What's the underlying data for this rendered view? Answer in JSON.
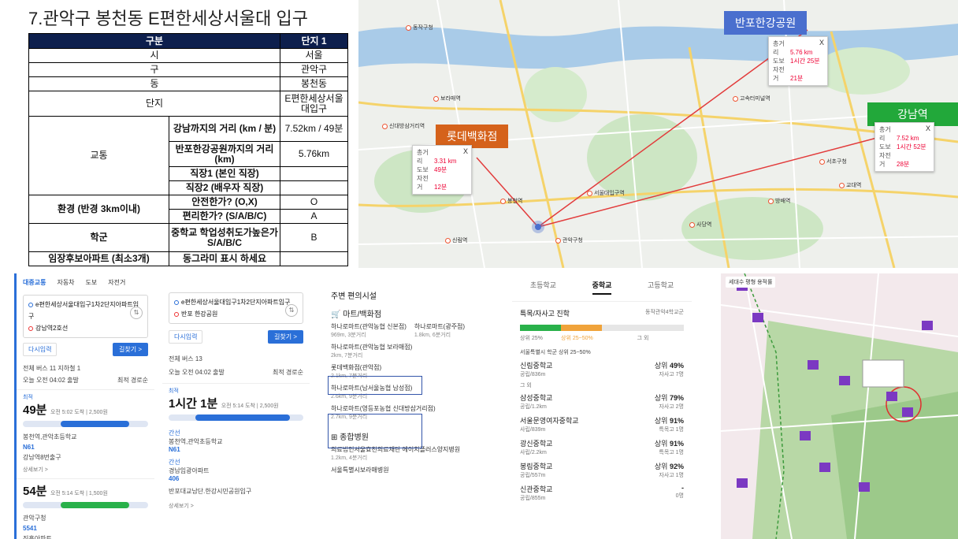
{
  "title": "7.관악구 봉천동 E편한세상서울대 입구",
  "table": {
    "header_left": "구분",
    "header_right": "단지 1",
    "rows": {
      "si_label": "시",
      "si_value": "서울",
      "gu_label": "구",
      "gu_value": "관악구",
      "dong_label": "동",
      "dong_value": "봉천동",
      "danji_label": "단지",
      "danji_value": "E편한세상서울대입구",
      "transport_label": "교통",
      "gangnam_label": "강남까지의 거리 (km / 분)",
      "gangnam_value": "7.52km / 49분",
      "banpo_label": "반포한강공원까지의 거리 (km)",
      "banpo_value": "5.76km",
      "job1_label": "직장1 (본인 직장)",
      "job2_label": "직장2 (배우자 직장)",
      "env_label": "환경 (반경 3km이내)",
      "safe_label": "안전한가? (O,X)",
      "safe_value": "O",
      "convenient_label": "편리한가? (S/A/B/C)",
      "convenient_value": "A",
      "school_label": "학군",
      "school_q_label": "중학교 학업성취도가높은가 S/A/B/C",
      "school_q_value": "B",
      "near_label": "임장후보아파트 (최소3개)",
      "near_value": "동그라미 표시 하세요"
    }
  },
  "map": {
    "banpo_label": "반포한강공원",
    "gangnam_label": "강남역",
    "lotte_label": "롯데백화점",
    "colors": {
      "blue_label": "#4a6fce",
      "green_label": "#22a83a",
      "orange_label": "#d5621b",
      "route": "#e23b3b"
    },
    "infobox_banpo": {
      "k1": "총거리",
      "v1": "5.76 km",
      "k2": "도보",
      "v2": "1시간 25분",
      "k3": "자전거",
      "v3": "21분"
    },
    "infobox_gangnam": {
      "k1": "총거리",
      "v1": "7.52 km",
      "k2": "도보",
      "v2": "1시간 52분",
      "k3": "자전거",
      "v3": "28분"
    },
    "infobox_lotte": {
      "k1": "총거리",
      "v1": "3.31 km",
      "k2": "도보",
      "v2": "49분",
      "k3": "자전거",
      "v3": "12분"
    },
    "close": "X",
    "pois": [
      "동작구청",
      "신대방삼거리역",
      "보라매역",
      "관악구청",
      "서울대입구역",
      "봉천역",
      "서초구청",
      "교대역",
      "방배역",
      "사당역",
      "고속터미널역",
      "신림역"
    ]
  },
  "panel1": {
    "tabs": [
      "대중교통",
      "자동차",
      "도보",
      "자전거"
    ],
    "from": "e편한세상서울대입구1차2단지아파트입구",
    "to": "강남역2호선",
    "reset": "다시입력",
    "search": "길찾기 >",
    "filters": "전체  버스 11  지하철 1",
    "today": "오늘 오전 04:02 출발",
    "sort": "최적 경로순",
    "best": "최적",
    "time1": "49분",
    "time1_detail": "오전 5:02 도착 | 2,500원",
    "bus1": "N61",
    "bus1_stop": "봉천역,관악초등학교",
    "stop_dest": "강남역8번출구",
    "more": "상세보기 >",
    "time2": "54분",
    "time2_detail": "오전 5:14 도착 | 1,500원",
    "bus2": "5541",
    "bus2_stop": "관악구청",
    "stop_dest2": "진흥아파트"
  },
  "panel2": {
    "from": "e편한세상서울대입구1차2단지아파트입구",
    "to": "반포 한강공원",
    "reset": "다시입력",
    "search": "길찾기 >",
    "filters": "전체  버스 13",
    "today": "오늘 오전 04:02 출발",
    "sort": "최적 경로순",
    "best": "최적",
    "time": "1시간 1분",
    "time_detail": "오전 5:14 도착 | 2,500원",
    "line1": "간선",
    "stop1": "봉천역,관악초등학교",
    "bus1": "N61",
    "line2": "간선",
    "stop2": "경남임광아파트",
    "bus2": "406",
    "dest": "반포대교남단.한강시민공원입구",
    "more": "상세보기 >"
  },
  "panel3": {
    "heading": "주변 편의시설",
    "category1": "마트/백화점",
    "items": [
      {
        "name": "하나로마트(관악농협 신본점)",
        "dist": "969m, 3분거리"
      },
      {
        "name": "하나로마트(광주점)",
        "dist": "1.8km, 6분거리"
      },
      {
        "name": "하나로마트(관악농협 보라매점)",
        "dist": "2km, 7분거리"
      },
      {
        "name": "롯데백화점(관악점)",
        "dist": "2.1km, 7분거리"
      },
      {
        "name": "하나로마트(남서울농협 남성점)",
        "dist": "2.6km, 9분거리"
      },
      {
        "name": "하나로마트(영등포농협 신대방삼거리점)",
        "dist": "2.7km, 9분거리"
      }
    ],
    "category2": "종합병원",
    "hospitals": [
      {
        "name": "의료법인서울효천의료재단 에이치플러스양지병원",
        "dist": "1.2km, 4분거리"
      },
      {
        "name": "서울특별시보라매병원",
        "dist": ""
      }
    ]
  },
  "panel4": {
    "tabs": [
      "초등학교",
      "중학교",
      "고등학교"
    ],
    "heading": "특목/자사고 진학",
    "region": "동작관악4학교군",
    "levels": [
      "상위 25%",
      "상위 25~50%",
      "그 외"
    ],
    "my_note": "서울특별시 학군 상위 25~50%",
    "schools": [
      {
        "name": "신림중학교",
        "sub": "공립/836m",
        "rate_label": "상위",
        "rate": "49%",
        "note": "자사고 7명"
      },
      {
        "name": "삼성중학교",
        "sub": "공립/1.2km",
        "rate_label": "상위",
        "rate": "79%",
        "note": "자사고 2명"
      },
      {
        "name": "서울문영여자중학교",
        "sub": "사립/839m",
        "rate_label": "상위",
        "rate": "91%",
        "note": "특목고 1명"
      },
      {
        "name": "광신중학교",
        "sub": "사립/2.2km",
        "rate_label": "상위",
        "rate": "91%",
        "note": "특목고 1명"
      },
      {
        "name": "봉림중학교",
        "sub": "공립/557m",
        "rate_label": "상위",
        "rate": "92%",
        "note": "자사고 1명"
      },
      {
        "name": "신관중학교",
        "sub": "공립/855m",
        "rate_label": "",
        "rate": "-",
        "note": "0명"
      }
    ],
    "other_label": "그 외"
  },
  "panel5": {
    "toolbar": "세대수  평형  용적률"
  }
}
